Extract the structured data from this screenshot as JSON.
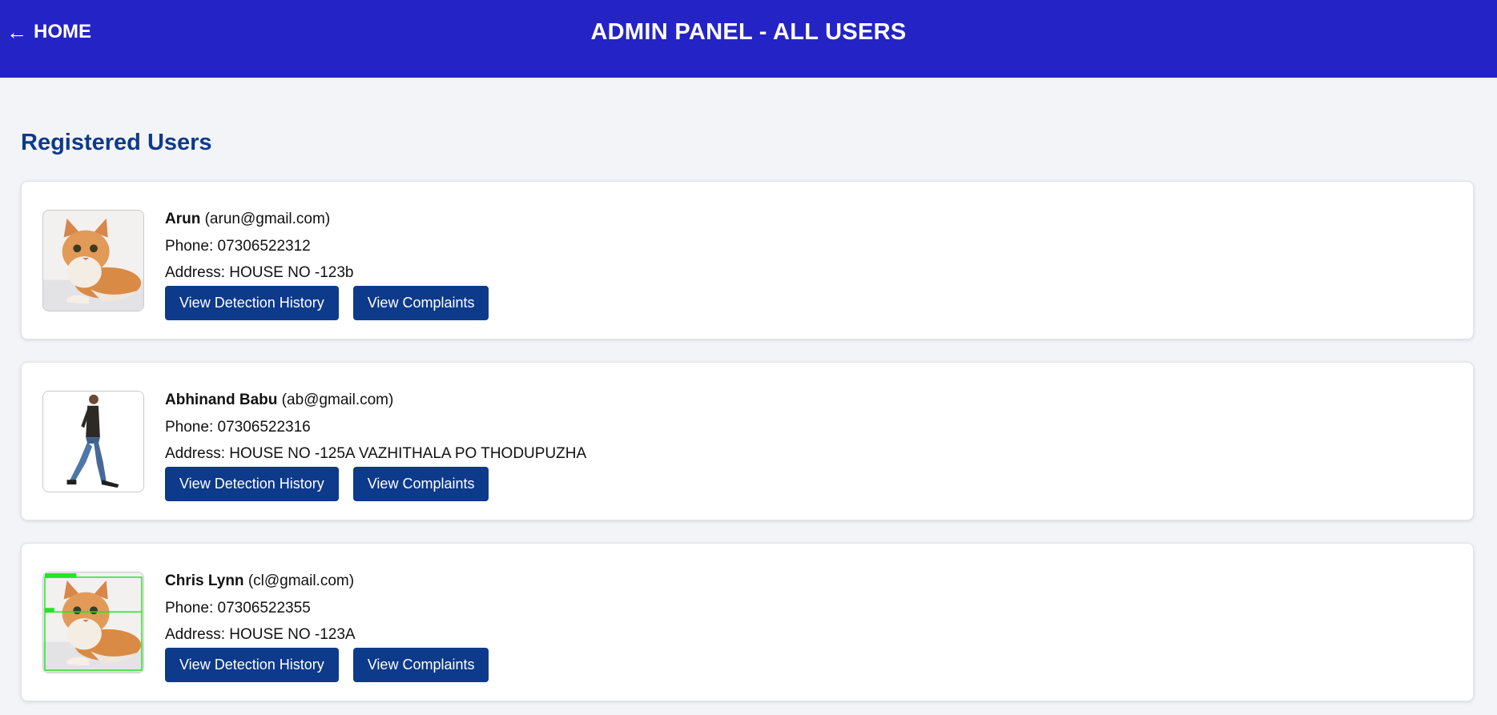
{
  "header": {
    "home_label": "HOME",
    "home_arrow": "←",
    "title": "ADMIN PANEL - ALL USERS",
    "background_color": "#2323c6"
  },
  "main": {
    "section_title": "Registered Users",
    "users": [
      {
        "name": "Arun",
        "email": "(arun@gmail.com)",
        "phone": "Phone: 07306522312",
        "address": "Address: HOUSE NO -123b",
        "avatar": "cat-photo",
        "detection_button": "View Detection History",
        "complaints_button": "View Complaints"
      },
      {
        "name": "Abhinand Babu",
        "email": "(ab@gmail.com)",
        "phone": "Phone: 07306522316",
        "address": "Address: HOUSE NO -125A VAZHITHALA PO THODUPUZHA",
        "avatar": "walking-person-photo",
        "detection_button": "View Detection History",
        "complaints_button": "View Complaints"
      },
      {
        "name": "Chris Lynn",
        "email": "(cl@gmail.com)",
        "phone": "Phone: 07306522355",
        "address": "Address: HOUSE NO -123A",
        "avatar": "cat-photo-with-detection-boxes",
        "detection_button": "View Detection History",
        "complaints_button": "View Complaints"
      }
    ]
  },
  "colors": {
    "accent": "#0d3a8a",
    "page_background": "#f3f4f8"
  }
}
